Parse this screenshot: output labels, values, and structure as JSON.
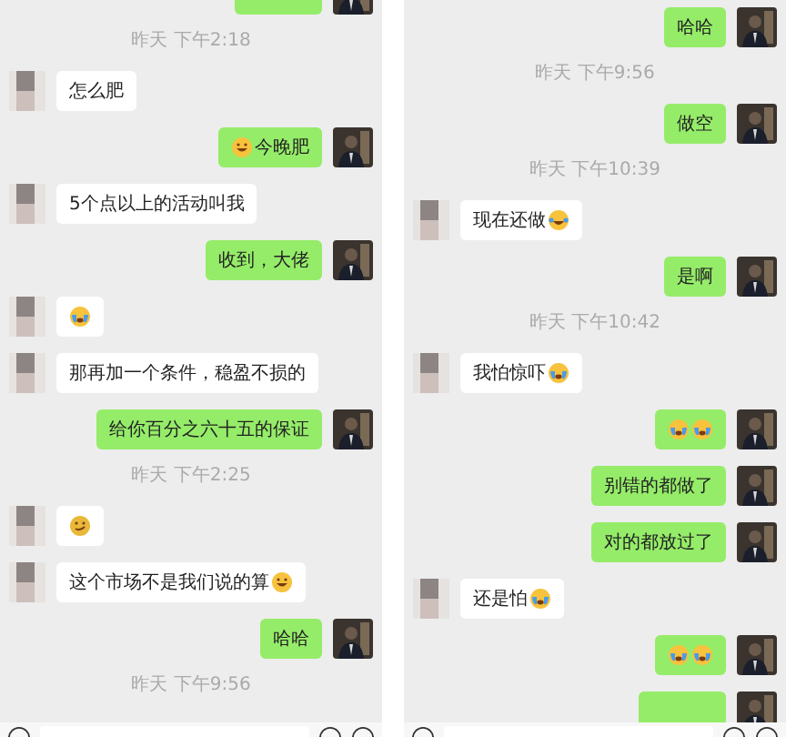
{
  "panels": [
    {
      "items": [
        {
          "kind": "cut_bubble",
          "outgoing": true
        },
        {
          "kind": "time",
          "text": "昨天 下午2:18"
        },
        {
          "kind": "message",
          "outgoing": false,
          "parts": [
            {
              "kind": "text",
              "text": "怎么肥"
            }
          ]
        },
        {
          "kind": "message",
          "outgoing": true,
          "parts": [
            {
              "kind": "grin"
            },
            {
              "kind": "text",
              "text": "今晚肥"
            }
          ]
        },
        {
          "kind": "message",
          "outgoing": false,
          "parts": [
            {
              "kind": "text",
              "text": "5个点以上的活动叫我"
            }
          ]
        },
        {
          "kind": "message",
          "outgoing": true,
          "parts": [
            {
              "kind": "text",
              "text": "收到，大佬"
            }
          ]
        },
        {
          "kind": "message",
          "outgoing": false,
          "parts": [
            {
              "kind": "crying"
            }
          ]
        },
        {
          "kind": "message",
          "outgoing": false,
          "parts": [
            {
              "kind": "text",
              "text": "那再加一个条件，稳盈不损的"
            }
          ]
        },
        {
          "kind": "message",
          "outgoing": true,
          "parts": [
            {
              "kind": "text",
              "text": "给你百分之六十五的保证"
            }
          ]
        },
        {
          "kind": "time",
          "text": "昨天 下午2:25"
        },
        {
          "kind": "message",
          "outgoing": false,
          "parts": [
            {
              "kind": "smirk"
            }
          ]
        },
        {
          "kind": "message",
          "outgoing": false,
          "parts": [
            {
              "kind": "text",
              "text": "这个市场不是我们说的算"
            },
            {
              "kind": "grin"
            }
          ]
        },
        {
          "kind": "message",
          "outgoing": true,
          "parts": [
            {
              "kind": "text",
              "text": "哈哈"
            }
          ]
        },
        {
          "kind": "time",
          "text": "昨天 下午9:56"
        }
      ]
    },
    {
      "items": [
        {
          "kind": "message",
          "outgoing": true,
          "parts": [
            {
              "kind": "text",
              "text": "哈哈"
            }
          ]
        },
        {
          "kind": "time",
          "text": "昨天 下午9:56"
        },
        {
          "kind": "message",
          "outgoing": true,
          "parts": [
            {
              "kind": "text",
              "text": "做空"
            }
          ]
        },
        {
          "kind": "time",
          "text": "昨天 下午10:39"
        },
        {
          "kind": "message",
          "outgoing": false,
          "parts": [
            {
              "kind": "text",
              "text": "现在还做"
            },
            {
              "kind": "laugh_tears"
            }
          ]
        },
        {
          "kind": "message",
          "outgoing": true,
          "parts": [
            {
              "kind": "text",
              "text": "是啊"
            }
          ]
        },
        {
          "kind": "time",
          "text": "昨天 下午10:42"
        },
        {
          "kind": "message",
          "outgoing": false,
          "parts": [
            {
              "kind": "text",
              "text": "我怕惊吓"
            },
            {
              "kind": "crying"
            }
          ]
        },
        {
          "kind": "message",
          "outgoing": true,
          "parts": [
            {
              "kind": "crying"
            },
            {
              "kind": "crying"
            }
          ]
        },
        {
          "kind": "message",
          "outgoing": true,
          "parts": [
            {
              "kind": "text",
              "text": "别错的都做了"
            }
          ]
        },
        {
          "kind": "message",
          "outgoing": true,
          "parts": [
            {
              "kind": "text",
              "text": "对的都放过了"
            }
          ]
        },
        {
          "kind": "message",
          "outgoing": false,
          "parts": [
            {
              "kind": "text",
              "text": "还是怕"
            },
            {
              "kind": "crying"
            }
          ]
        },
        {
          "kind": "message",
          "outgoing": true,
          "parts": [
            {
              "kind": "crying"
            },
            {
              "kind": "crying"
            }
          ]
        },
        {
          "kind": "cut_bubble",
          "outgoing": true
        }
      ]
    }
  ]
}
